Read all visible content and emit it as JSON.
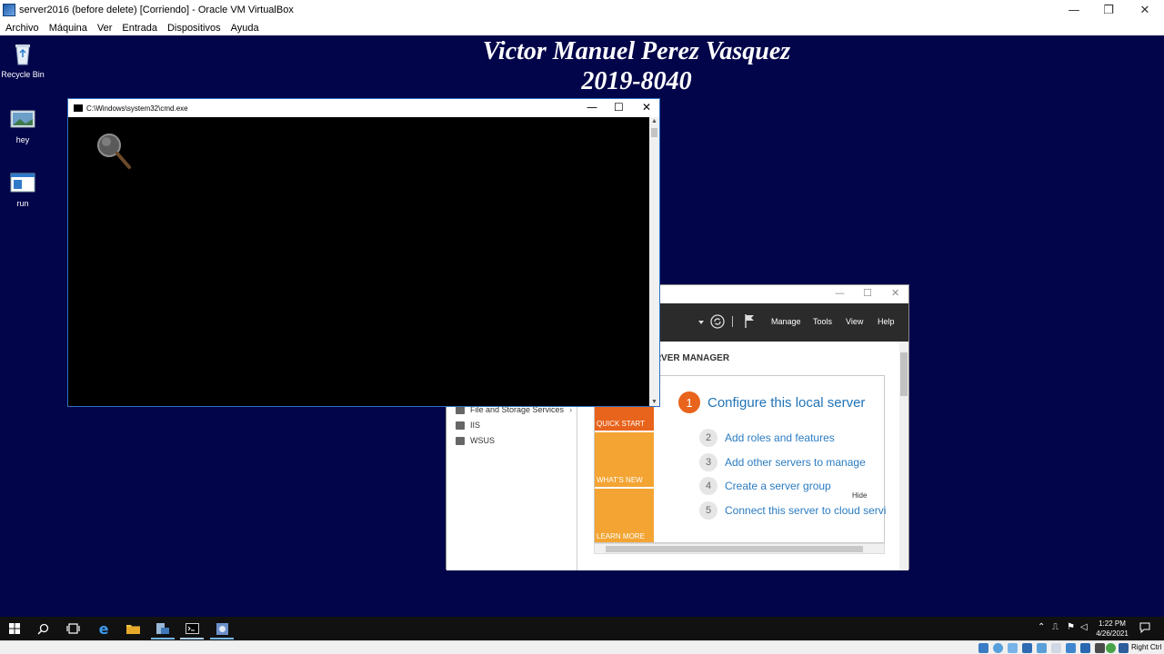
{
  "vbox": {
    "window_title": "server2016 (before delete) [Corriendo] - Oracle VM VirtualBox",
    "controls": {
      "minimize": "—",
      "restore": "❐",
      "close": "✕"
    },
    "menu": [
      "Archivo",
      "Máquina",
      "Ver",
      "Entrada",
      "Dispositivos",
      "Ayuda"
    ],
    "host_key": "Right Ctrl"
  },
  "desktop": {
    "banner_name": "Victor Manuel Perez Vasquez",
    "banner_id": "2019-8040",
    "icons": [
      {
        "label": "Recycle Bin",
        "icon": "recycle-bin-icon"
      },
      {
        "label": "hey",
        "icon": "image-file-icon"
      },
      {
        "label": "run",
        "icon": "window-shortcut-icon"
      }
    ],
    "background_color": "#03054a"
  },
  "cmd": {
    "title": "C:\\Windows\\system32\\cmd.exe",
    "controls": {
      "minimize": "—",
      "maximize": "☐",
      "close": "✕"
    }
  },
  "server_manager": {
    "controls": {
      "minimize": "—",
      "maximize": "☐",
      "close": "✕"
    },
    "menu": [
      "Manage",
      "Tools",
      "View",
      "Help"
    ],
    "nav": [
      "File and Storage Services",
      "IIS",
      "WSUS"
    ],
    "heading": "RVER MANAGER",
    "tiles": [
      "QUICK START",
      "WHAT'S NEW",
      "LEARN MORE"
    ],
    "step1": {
      "number": "1",
      "label": "Configure this local server"
    },
    "steps": [
      {
        "number": "2",
        "label": "Add roles and features"
      },
      {
        "number": "3",
        "label": "Add other servers to manage"
      },
      {
        "number": "4",
        "label": "Create a server group"
      },
      {
        "number": "5",
        "label": "Connect this server to cloud servic"
      }
    ],
    "hide": "Hide",
    "accent": "#e8631c",
    "tile_color": "#f3a432"
  },
  "taskbar": {
    "time": "1:22 PM",
    "date": "4/26/2021",
    "apps": [
      "start-icon",
      "search-icon",
      "task-view-icon",
      "internet-explorer-icon",
      "file-explorer-icon",
      "server-manager-icon",
      "cmd-icon",
      "app-icon"
    ]
  }
}
